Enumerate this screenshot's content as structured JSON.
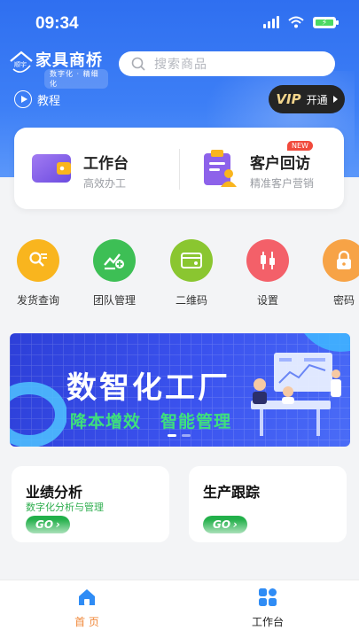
{
  "status_bar": {
    "time": "09:34"
  },
  "header": {
    "logo_small": "顺宇",
    "logo_title": "家具商桥",
    "logo_sub": "数字化 · 精细化",
    "search_placeholder": "搜索商品"
  },
  "sub_row": {
    "tutorial_label": "教程",
    "vip_badge": "VIP",
    "vip_action": "开通"
  },
  "main_card": {
    "left": {
      "title": "工作台",
      "subtitle": "高效办工"
    },
    "right": {
      "title": "客户回访",
      "subtitle": "精准客户营销",
      "badge": "NEW"
    }
  },
  "quick_actions": [
    {
      "label": "发货查询",
      "icon": "search-doc-icon",
      "color": "#f9b51e"
    },
    {
      "label": "团队管理",
      "icon": "chart-add-icon",
      "color": "#3dbf55"
    },
    {
      "label": "二维码",
      "icon": "card-icon",
      "color": "#8ac630"
    },
    {
      "label": "设置",
      "icon": "candlestick-icon",
      "color": "#f36069"
    },
    {
      "label": "密码",
      "icon": "lock-icon",
      "color": "#f7a346"
    }
  ],
  "banner": {
    "title": "数智化工厂",
    "tag1": "降本增效",
    "tag2": "智能管理"
  },
  "tiles": [
    {
      "title": "业绩分析",
      "subtitle": "数字化分析与管理",
      "button": "GO"
    },
    {
      "title": "生产跟踪",
      "subtitle": "",
      "button": "GO"
    }
  ],
  "tabbar": [
    {
      "label": "首 页",
      "icon": "home-icon",
      "active": true,
      "color": "#f0883a"
    },
    {
      "label": "工作台",
      "icon": "grid-icon",
      "active": false,
      "color": "#222222"
    }
  ],
  "colors": {
    "primary": "#2f6ff0",
    "accent_green": "#22b04a",
    "active_tab": "#f0883a"
  }
}
